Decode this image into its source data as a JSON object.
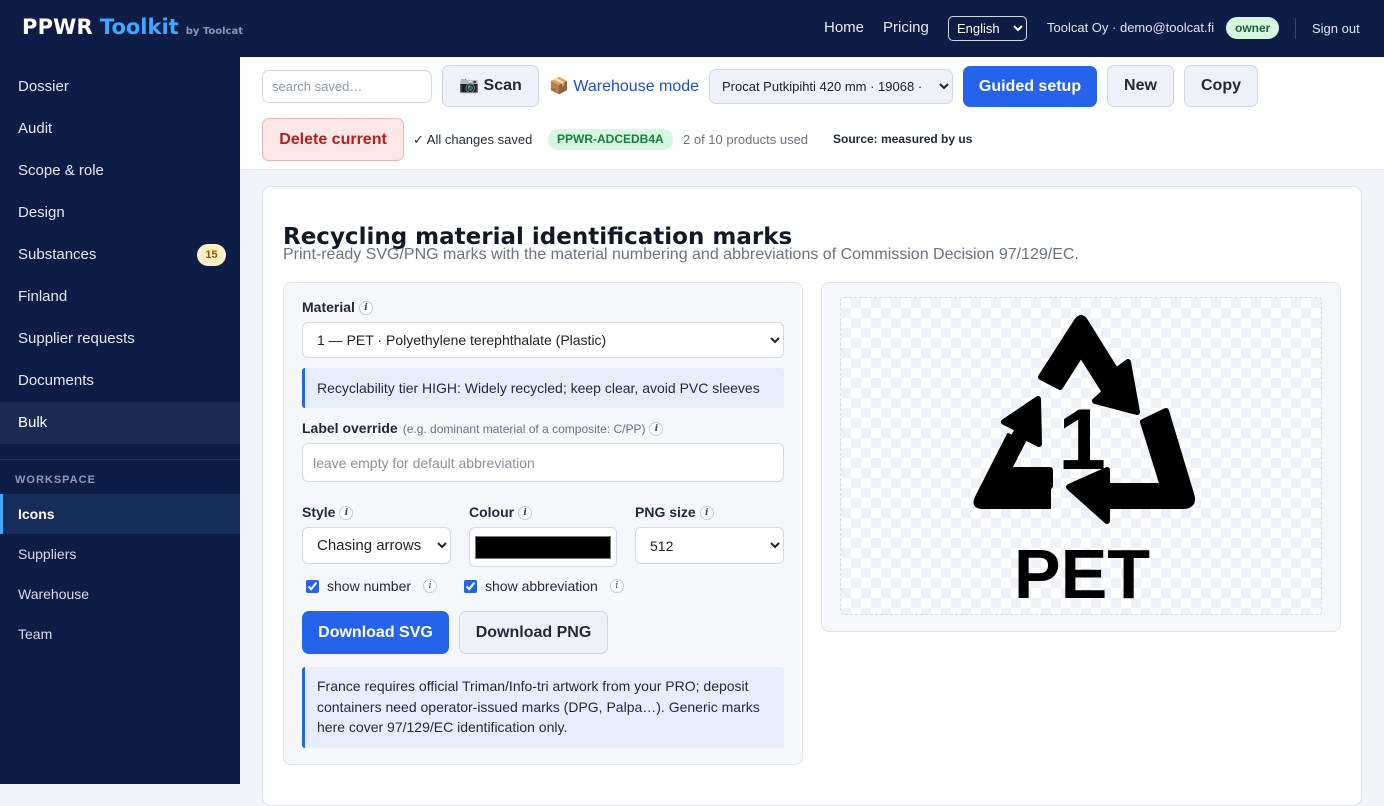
{
  "brand": {
    "name": "PPWR",
    "accent": "Toolkit",
    "by": "by Toolcat"
  },
  "topnav": {
    "home": "Home",
    "pricing": "Pricing",
    "language": "English",
    "account": "Toolcat Oy · demo@toolcat.fi",
    "role": "owner",
    "signout": "Sign out"
  },
  "sidebar": {
    "items": [
      {
        "label": "Dossier"
      },
      {
        "label": "Audit"
      },
      {
        "label": "Scope & role"
      },
      {
        "label": "Design"
      },
      {
        "label": "Substances",
        "badge": "15"
      },
      {
        "label": "Finland"
      },
      {
        "label": "Supplier requests"
      },
      {
        "label": "Documents"
      },
      {
        "label": "Bulk",
        "active": true
      }
    ],
    "workspace_label": "WORKSPACE",
    "workspace_items": [
      {
        "label": "Icons",
        "active": true
      },
      {
        "label": "Suppliers"
      },
      {
        "label": "Warehouse"
      },
      {
        "label": "Team"
      }
    ]
  },
  "toolbar": {
    "search_placeholder": "search saved…",
    "scan_label": "📷 Scan",
    "warehouse_mode": "📦 Warehouse mode",
    "product_selected": "Procat Putkipihti 420 mm · 19068 ·",
    "guided_label": "Guided setup",
    "new_label": "New",
    "copy_label": "Copy",
    "delete_label": "Delete current",
    "saved_status": "✓ All changes saved",
    "product_id": "PPWR-ADCEDB4A",
    "usage": "2 of 10 products used",
    "source": "Source: measured by us"
  },
  "page": {
    "title": "Recycling material identification marks",
    "subtitle": "Print-ready SVG/PNG marks with the material numbering and abbreviations of Commission Decision 97/129/EC."
  },
  "form": {
    "material_label": "Material",
    "material_selected": "1 — PET · Polyethylene terephthalate (Plastic)",
    "recyclability_note": "Recyclability tier HIGH: Widely recycled; keep clear, avoid PVC sleeves",
    "override_label": "Label override",
    "override_hint": "(e.g. dominant material of a composite: C/PP)",
    "override_placeholder": "leave empty for default abbreviation",
    "style_label": "Style",
    "style_selected": "Chasing arrows (",
    "colour_label": "Colour",
    "colour_value": "#000000",
    "png_size_label": "PNG size",
    "png_size_selected": "512",
    "show_number_label": "show number",
    "show_number_checked": true,
    "show_abbrev_label": "show abbreviation",
    "show_abbrev_checked": true,
    "download_svg": "Download SVG",
    "download_png": "Download PNG",
    "france_note": "France requires official Triman/Info-tri artwork from your PRO; deposit containers need operator-issued marks (DPG, Palpa…). Generic marks here cover 97/129/EC identification only."
  },
  "preview": {
    "number": "1",
    "abbreviation": "PET",
    "icon": "chasing-arrows-recycling-icon"
  },
  "colors": {
    "navy": "#0e1d45",
    "accent_blue": "#2563eb",
    "brand_cyan": "#3ea8ff",
    "danger": "#b91c1c",
    "success": "#15803d"
  }
}
